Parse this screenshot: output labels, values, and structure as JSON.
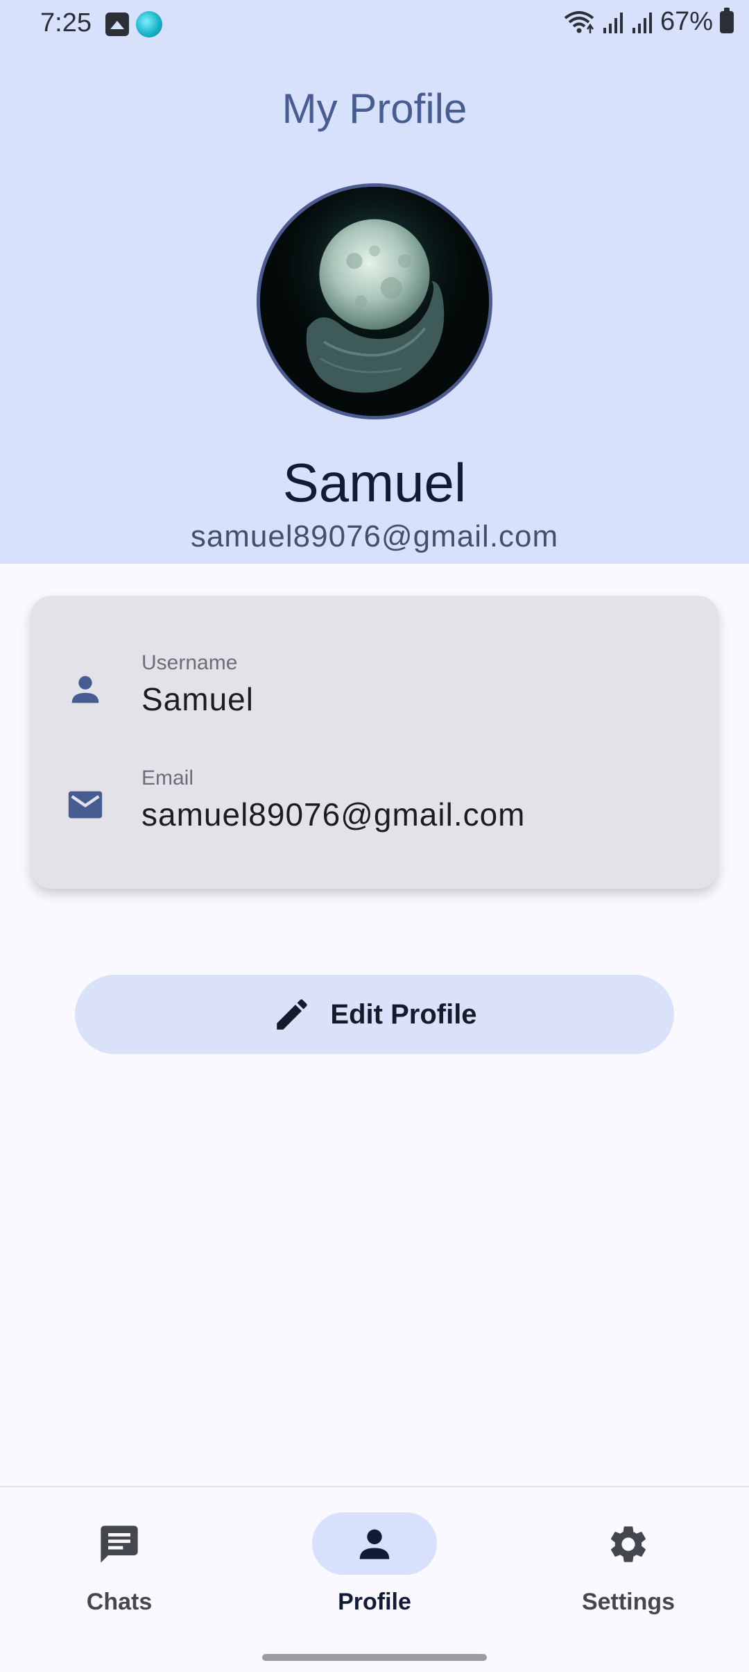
{
  "status_bar": {
    "time": "7:25",
    "battery": "67%"
  },
  "header": {
    "title": "My Profile",
    "name": "Samuel",
    "email": "samuel89076@gmail.com"
  },
  "info_card": {
    "username_label": "Username",
    "username_value": "Samuel",
    "email_label": "Email",
    "email_value": "samuel89076@gmail.com"
  },
  "actions": {
    "edit_label": "Edit Profile"
  },
  "bottom_nav": {
    "items": [
      {
        "label": "Chats",
        "icon": "chat-icon"
      },
      {
        "label": "Profile",
        "icon": "person-icon",
        "selected": true
      },
      {
        "label": "Settings",
        "icon": "gear-icon"
      }
    ]
  },
  "colors": {
    "header_bg": "#d8e1fb",
    "accent": "#475c91",
    "card_bg": "#e3e2e8",
    "button_bg": "#dae2f9"
  }
}
